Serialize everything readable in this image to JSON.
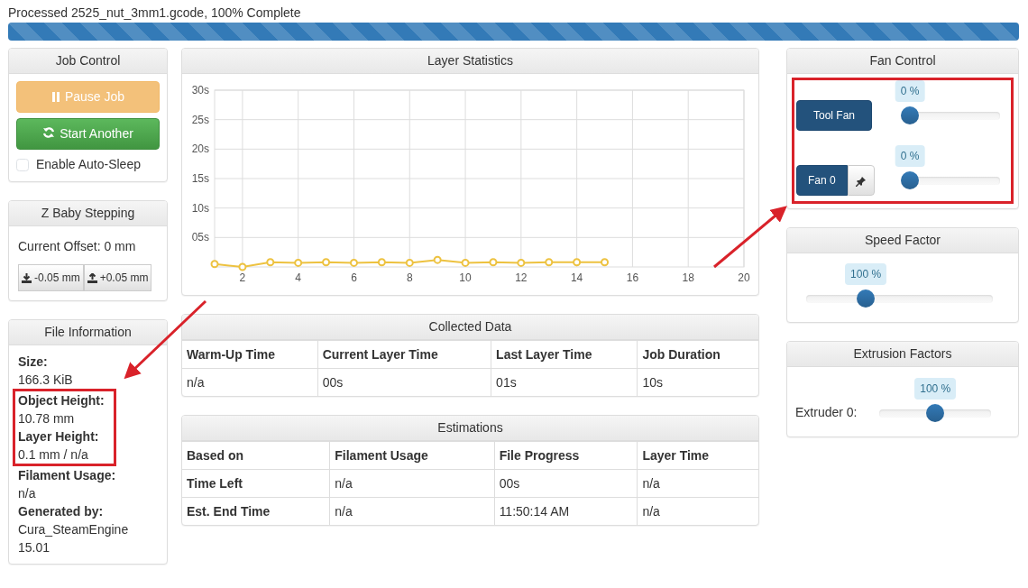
{
  "progress": {
    "label": "Processed 2525_nut_3mm1.gcode, 100% Complete",
    "level": 1.0
  },
  "job_control": {
    "title": "Job Control",
    "buttons": [
      {
        "label": "Pause Job",
        "kind": "pause",
        "disabled": true
      },
      {
        "label": "Start Another",
        "kind": "restart",
        "disabled": false
      }
    ],
    "auto_sleep": {
      "label": "Enable Auto-Sleep",
      "checked": false
    }
  },
  "z_baby_stepping": {
    "title": "Z Baby Stepping",
    "offset": "Current Offset: 0 mm",
    "buttons": [
      {
        "label": "-0.05 mm",
        "kind": "down"
      },
      {
        "label": "+0.05 mm",
        "kind": "up"
      }
    ]
  },
  "file_information": {
    "title": "File Information",
    "items": [
      {
        "label": "Size:",
        "value": "166.3 KiB",
        "highlighted": false
      },
      {
        "label": "Object Height:",
        "value": "10.78 mm",
        "highlighted": true
      },
      {
        "label": "Layer Height:",
        "value": "0.1 mm / n/a",
        "highlighted": true
      },
      {
        "label": "Filament Usage:",
        "value": "n/a",
        "highlighted": false
      },
      {
        "label": "Generated by:",
        "value": "Cura_SteamEngine 15.01",
        "highlighted": false
      }
    ]
  },
  "layer_statistics": {
    "title": "Layer Statistics",
    "chart_data": {
      "type": "line",
      "x": [
        1,
        2,
        3,
        4,
        5,
        6,
        7,
        8,
        9,
        10,
        11,
        12,
        13,
        14,
        15
      ],
      "grid": true,
      "series": [
        {
          "color": "#edc240",
          "marker": "circle",
          "values": [
            0.5,
            0,
            0.8,
            0.7,
            0.8,
            0.7,
            0.8,
            0.7,
            1.2,
            0.7,
            0.8,
            0.7,
            0.8,
            0.8,
            0.8
          ]
        }
      ],
      "xlim": [
        1,
        20
      ],
      "ylim": [
        0,
        30
      ],
      "xticks": [
        2,
        4,
        6,
        8,
        10,
        12,
        14,
        16,
        18,
        20
      ],
      "yticks": [
        {
          "value": 5,
          "label": "05s"
        },
        {
          "value": 10,
          "label": "10s"
        },
        {
          "value": 15,
          "label": "15s"
        },
        {
          "value": 20,
          "label": "20s"
        },
        {
          "value": 25,
          "label": "25s"
        },
        {
          "value": 30,
          "label": "30s"
        }
      ]
    }
  },
  "collected_data": {
    "title": "Collected Data",
    "columns": [
      "Warm-Up Time",
      "Current Layer Time",
      "Last Layer Time",
      "Job Duration"
    ],
    "rows": [
      [
        "n/a",
        "00s",
        "01s",
        "10s"
      ]
    ]
  },
  "estimations": {
    "title": "Estimations",
    "columns": [
      "Based on",
      "Filament Usage",
      "File Progress",
      "Layer Time"
    ],
    "rows": [
      [
        "Time Left",
        "n/a",
        "00s",
        "n/a"
      ],
      [
        "Est. End Time",
        "n/a",
        "11:50:14 AM",
        "n/a"
      ]
    ]
  },
  "fan_control": {
    "title": "Fan Control",
    "highlighted": true,
    "fans": [
      {
        "label": "Tool Fan",
        "reading": "0 %",
        "level": 0,
        "pinnable": false
      },
      {
        "label": "Fan 0",
        "reading": "0 %",
        "level": 0,
        "pinnable": true
      }
    ]
  },
  "speed_factor": {
    "title": "Speed Factor",
    "reading": "100 %",
    "level": 0.3
  },
  "extrusion_factors": {
    "title": "Extrusion Factors",
    "extruders": [
      {
        "label": "Extruder 0:",
        "reading": "100 %",
        "level": 0.5
      }
    ]
  }
}
